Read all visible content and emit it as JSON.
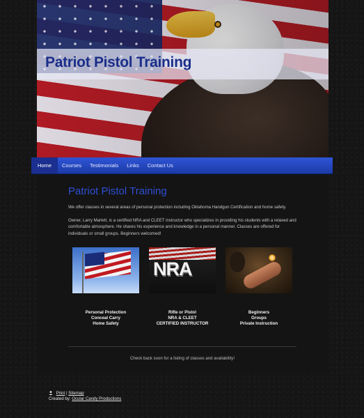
{
  "site": {
    "title": "Patriot Pistol Training"
  },
  "nav": {
    "items": [
      {
        "label": "Home",
        "active": true
      },
      {
        "label": "Courses",
        "active": false
      },
      {
        "label": "Testimonials",
        "active": false
      },
      {
        "label": "Links",
        "active": false
      },
      {
        "label": "Contact Us",
        "active": false
      }
    ]
  },
  "main": {
    "heading": "Patriot Pistol Training",
    "paragraphs": [
      "We offer classes in several areas of personal protection including Oklahoma Handgun Certification and home safety.",
      "Owner, Larry Marlett, is a certified NRA and CLEET instructor who specializes in providing his students with a relaxed and comfortable atmosphere. He shares his experience and knowledge in a personal manner. Classes are offered for individuals or small groups.  Beginners welcomed!"
    ],
    "images": [
      {
        "icon": "american-flag-photo"
      },
      {
        "icon": "nra-logo-photo",
        "text": "NRA"
      },
      {
        "icon": "pistol-shooter-photo"
      }
    ],
    "columns": [
      {
        "lines": [
          "Personal Protection",
          "Conceal Carry",
          "Home Safety"
        ]
      },
      {
        "lines": [
          "Rifle or Pistol",
          "NRA & CLEET",
          "CERTIFIED INSTRUCTOR"
        ]
      },
      {
        "lines": [
          "Beginners",
          "Groups",
          "Private Instruction"
        ]
      }
    ],
    "note": "Check back soon for a listing of classes and availability!"
  },
  "footer": {
    "print": "Print",
    "separator": "|",
    "sitemap": "Sitemap",
    "created_by_label": "Created by:",
    "created_by_link": "Ocular Candy Productions"
  },
  "colors": {
    "nav": "#2f55d6",
    "heading": "#2d4fd4",
    "title": "#1a2e8a",
    "page_bg": "#141414"
  }
}
